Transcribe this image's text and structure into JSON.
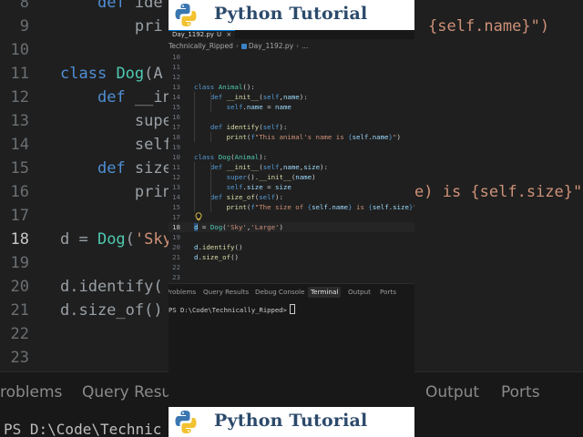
{
  "brand": {
    "title": "Python Tutorial"
  },
  "editor_tab": {
    "filename": "Day_1192.py",
    "modified_marker": "U"
  },
  "breadcrumb": {
    "folder": "Technically_Ripped",
    "file": "Day_1192.py",
    "more": "..."
  },
  "code_lines": [
    {
      "n": "10",
      "t": ""
    },
    {
      "n": "11",
      "t": ""
    },
    {
      "n": "12",
      "t": ""
    },
    {
      "n": "13",
      "t": "class Animal():"
    },
    {
      "n": "14",
      "t": "    def __init__(self,name):"
    },
    {
      "n": "15",
      "t": "        self.name = name"
    },
    {
      "n": "16",
      "t": ""
    },
    {
      "n": "17",
      "t": "    def identify(self):"
    },
    {
      "n": "18",
      "t": "        print(f\"This animal's name is {self.name}\")"
    },
    {
      "n": "19",
      "t": ""
    },
    {
      "n": "10",
      "t": "class Dog(Animal):"
    },
    {
      "n": "11",
      "t": "    def __init__(self,name,size):"
    },
    {
      "n": "12",
      "t": "        super().__init__(name)"
    },
    {
      "n": "13",
      "t": "        self.size = size"
    },
    {
      "n": "14",
      "t": "    def size_of(self):"
    },
    {
      "n": "15",
      "t": "        print(f\"The size of {self.name} is {self.size}\")"
    },
    {
      "n": "17",
      "t": ""
    },
    {
      "n": "18",
      "t": "d = Dog('Sky','Large')"
    },
    {
      "n": "19",
      "t": ""
    },
    {
      "n": "20",
      "t": "d.identify()"
    },
    {
      "n": "21",
      "t": "d.size_of()"
    },
    {
      "n": "22",
      "t": ""
    },
    {
      "n": "23",
      "t": ""
    }
  ],
  "panel": {
    "tabs": [
      "Problems",
      "Query Results",
      "Debug Console",
      "Terminal",
      "Output",
      "Ports"
    ],
    "active_tab": "Terminal",
    "prompt": "PS D:\\Code\\Technically_Ripped>"
  },
  "background": {
    "lines": [
      {
        "n": "8",
        "t": "    def ide"
      },
      {
        "n": "9",
        "t": "        pri"
      },
      {
        "n": "10",
        "t": ""
      },
      {
        "n": "11",
        "t": "class Dog(A"
      },
      {
        "n": "12",
        "t": "    def __in"
      },
      {
        "n": "13",
        "t": "        supe"
      },
      {
        "n": "14",
        "t": "        self"
      },
      {
        "n": "15",
        "t": "    def size"
      },
      {
        "n": "16",
        "t": "        print"
      },
      {
        "n": "17",
        "t": ""
      },
      {
        "n": "18",
        "t": "d = Dog('Sky"
      },
      {
        "n": "19",
        "t": ""
      },
      {
        "n": "20",
        "t": "d.identify("
      },
      {
        "n": "21",
        "t": "d.size_of()"
      },
      {
        "n": "22",
        "t": ""
      },
      {
        "n": "23",
        "t": ""
      }
    ],
    "right_fragments": {
      "row1": "{self.name}\")",
      "row8": "e) is {self.size}\""
    },
    "tabs": [
      "roblems",
      "Query Resul",
      "Output",
      "Ports"
    ],
    "terminal": "PS D:\\Code\\Technic"
  },
  "colors": {
    "keyword": "#569cd6",
    "class": "#4ec9b0",
    "function": "#dcdcaa",
    "string": "#ce9178",
    "variable": "#9cdcfe",
    "brand": "#2c4a6b"
  }
}
